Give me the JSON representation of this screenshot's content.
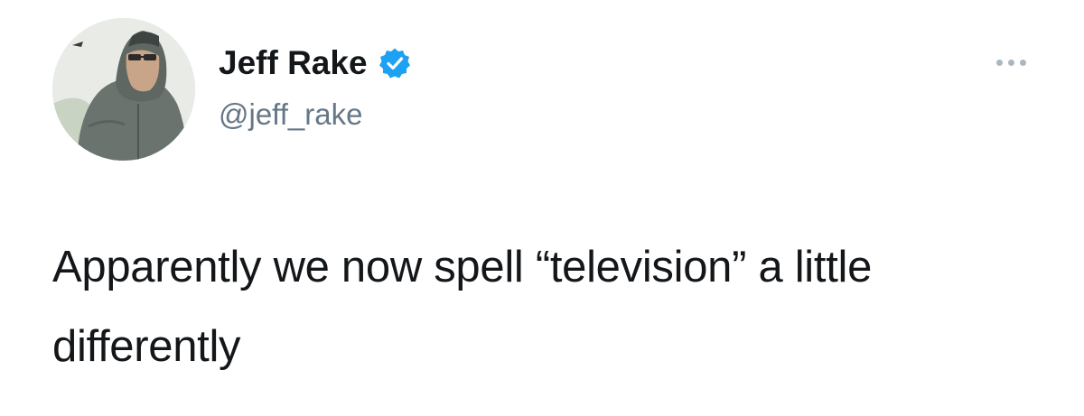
{
  "tweet": {
    "author": {
      "display_name": "Jeff Rake",
      "handle": "@jeff_rake",
      "verified": true,
      "avatar_icon": "profile-photo"
    },
    "text": "Apparently we now spell “television” a little differently",
    "more_icon": "more-options-icon"
  },
  "colors": {
    "text_primary": "#14171a",
    "text_secondary": "#657786",
    "verified_blue": "#1da1f2",
    "icon_gray": "#aab8c2",
    "background": "#ffffff"
  }
}
